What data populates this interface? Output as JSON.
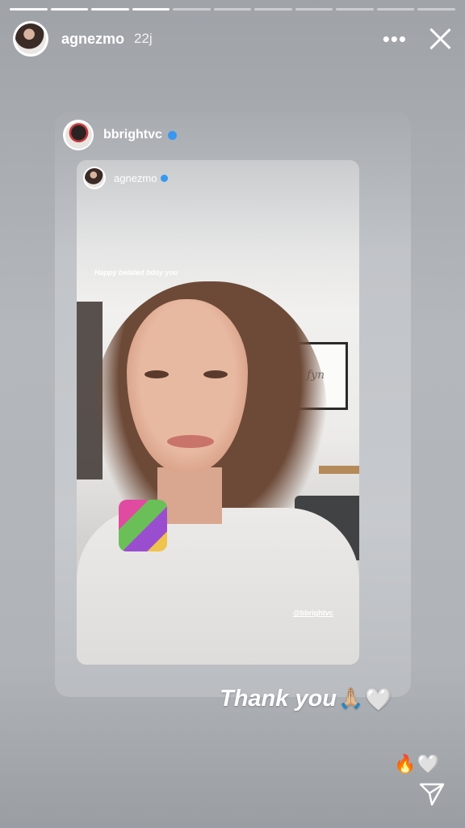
{
  "progress": {
    "total_segments": 11,
    "completed_segments": 4
  },
  "header": {
    "username": "agnezmo",
    "time": "22j",
    "more_icon": "more-options-icon",
    "close_icon": "close-icon"
  },
  "shared_post": {
    "username": "bbrightvc",
    "verified": true,
    "inner_story": {
      "username": "agnezmo",
      "verified": true,
      "caption": "Happy belated bday you",
      "mention": "@bbrightvc"
    }
  },
  "caption": {
    "text": "Thank you",
    "emojis": [
      "🙏🏼",
      "🤍"
    ]
  },
  "reactions": [
    "🔥",
    "🤍"
  ],
  "send_icon": "send-icon",
  "colors": {
    "verified": "#3897f0",
    "background": "#b4b8bc"
  }
}
